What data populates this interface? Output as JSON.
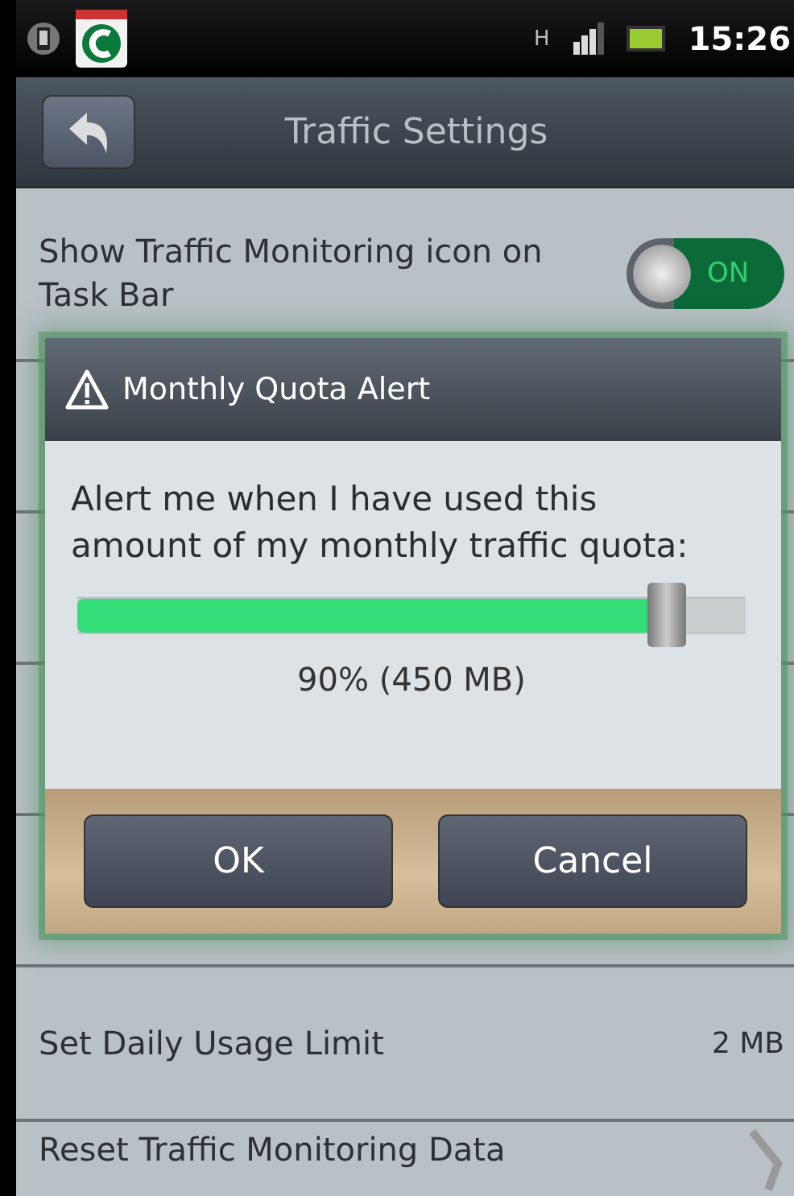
{
  "status_bar": {
    "time": "15:26",
    "network": "H"
  },
  "header": {
    "title": "Traffic Settings"
  },
  "settings": [
    {
      "kind": "toggle",
      "label": "Show Traffic Monitoring icon on Task Bar",
      "on": true,
      "toggle_label": "ON"
    },
    {
      "kind": "hidden"
    },
    {
      "kind": "hidden"
    },
    {
      "kind": "hidden"
    },
    {
      "kind": "hidden"
    },
    {
      "kind": "value",
      "label": "Set Daily Usage Limit",
      "value": "2 MB"
    },
    {
      "kind": "link",
      "label": "Reset Traffic Monitoring Data"
    }
  ],
  "dialog": {
    "title": "Monthly Quota Alert",
    "message": "Alert me when I have used this amount of my monthly traffic quota:",
    "slider": {
      "level": 0.9
    },
    "reading": "90% (450 MB)",
    "buttons": [
      "OK",
      "Cancel"
    ]
  }
}
